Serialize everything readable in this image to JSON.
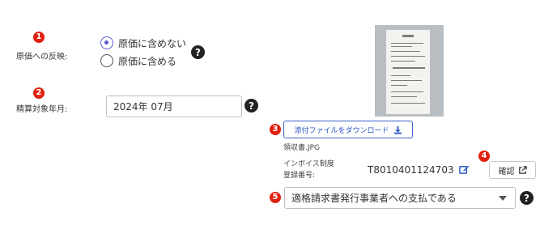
{
  "markers": [
    "1",
    "2",
    "3",
    "4",
    "5"
  ],
  "cost_reflection": {
    "label": "原価への反映:",
    "options": [
      {
        "label": "原価に含めない",
        "checked": true
      },
      {
        "label": "原価に含める",
        "checked": false
      }
    ],
    "help": "?"
  },
  "settlement": {
    "label": "精算対象年月:",
    "value": "2024年 07月",
    "help": "?"
  },
  "attachment": {
    "download_label": "添付ファイルをダウンロード",
    "download_icon": "download-icon",
    "file_name": "領収書.JPG"
  },
  "invoice": {
    "label_line1": "インボイス制度",
    "label_line2": "登録番号:",
    "number": "T8010401124703",
    "edit_icon": "edit-icon",
    "confirm_label": "確認",
    "confirm_icon": "external-link-icon"
  },
  "payment_type": {
    "selected": "適格請求書発行事業者への支払である",
    "help": "?"
  },
  "colors": {
    "marker": "#e02010",
    "accent": "#2a56c6",
    "radio_checked": "#5b5bd6"
  }
}
